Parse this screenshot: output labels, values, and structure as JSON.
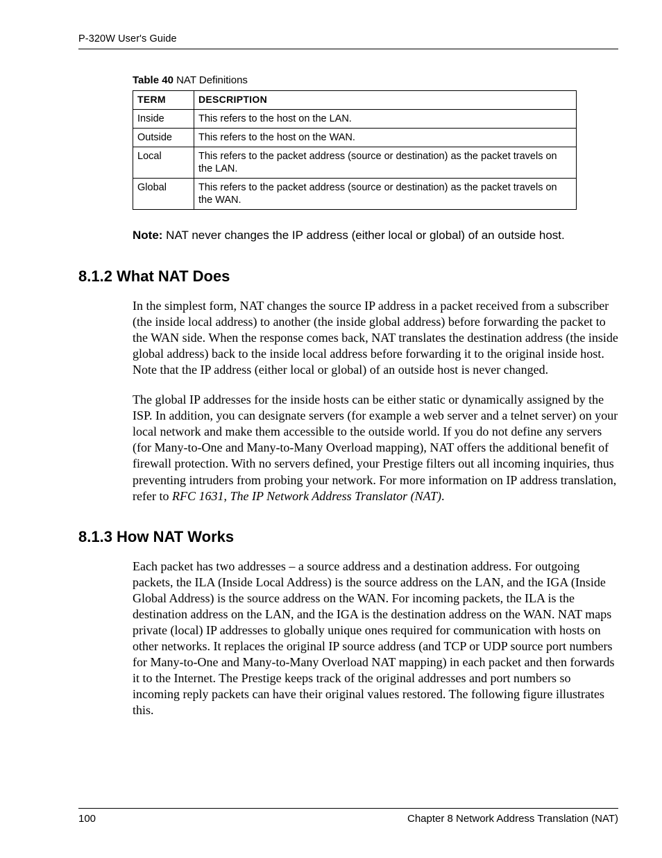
{
  "header": {
    "running_title": "P-320W User's Guide"
  },
  "table_caption": {
    "bold": "Table 40",
    "rest": "   NAT Definitions"
  },
  "table": {
    "headers": {
      "term": "TERM",
      "description": "DESCRIPTION"
    },
    "rows": [
      {
        "term": "Inside",
        "description": "This refers to the host on the LAN."
      },
      {
        "term": "Outside",
        "description": "This refers to the host on the WAN."
      },
      {
        "term": "Local",
        "description": "This refers to the packet address (source or destination) as the packet travels on the LAN."
      },
      {
        "term": "Global",
        "description": "This refers to the packet address (source or destination) as the packet travels on the WAN."
      }
    ]
  },
  "note": {
    "label": "Note:",
    "text": " NAT never changes the IP address (either local or global) of an outside host."
  },
  "sections": {
    "s1": {
      "heading": "8.1.2  What NAT Does",
      "p1": "In the simplest form, NAT changes the source IP address in a packet received from a subscriber (the inside local address) to another (the inside global address) before forwarding the packet to the WAN side. When the response comes back, NAT translates the destination address (the inside global address) back to the inside local address before forwarding it to the original inside host. Note that the IP address (either local or global) of an outside host is never changed.",
      "p2a": "The global IP addresses for the inside hosts can be either static or dynamically assigned by the ISP. In addition, you can designate servers (for example a web server and a telnet server) on your local network and make them accessible to the outside world. If you do not define any servers (for Many-to-One and Many-to-Many Overload mapping), NAT offers the additional benefit of firewall protection. With no servers defined, your Prestige filters out all incoming inquiries, thus preventing intruders from probing your network. For more information on IP address translation, refer to ",
      "p2_italic1": "RFC 1631",
      "p2_sep": ", ",
      "p2_italic2": "The IP Network Address Translator (NAT)",
      "p2_end": "."
    },
    "s2": {
      "heading": "8.1.3  How NAT Works",
      "p1": "Each packet has two addresses – a source address and a destination address. For outgoing packets, the ILA (Inside Local Address) is the source address on the LAN, and the IGA (Inside Global Address) is the source address on the WAN. For incoming packets, the ILA is the destination address on the LAN, and the IGA is the destination address on the WAN. NAT maps private (local) IP addresses to globally unique ones required for communication with hosts on other networks. It replaces the original IP source address (and TCP or UDP source port numbers for Many-to-One and Many-to-Many Overload NAT mapping) in each packet and then forwards it to the Internet. The Prestige keeps track of the original addresses and port numbers so incoming reply packets can have their original values restored. The following figure illustrates this."
    }
  },
  "footer": {
    "page_number": "100",
    "chapter": "Chapter 8 Network Address Translation (NAT)"
  }
}
